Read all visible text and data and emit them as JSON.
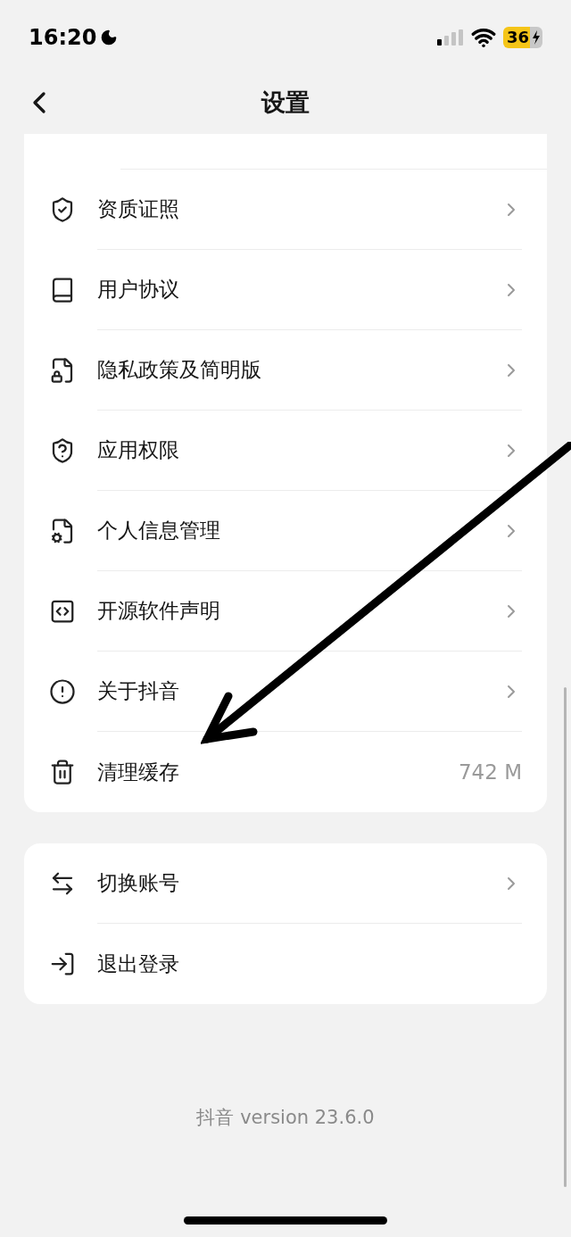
{
  "status_bar": {
    "time": "16:20",
    "battery": "36"
  },
  "header": {
    "title": "设置"
  },
  "settings": [
    {
      "label": "资质证照",
      "kind": "link"
    },
    {
      "label": "用户协议",
      "kind": "link"
    },
    {
      "label": "隐私政策及简明版",
      "kind": "link"
    },
    {
      "label": "应用权限",
      "kind": "link"
    },
    {
      "label": "个人信息管理",
      "kind": "link"
    },
    {
      "label": "开源软件声明",
      "kind": "link"
    },
    {
      "label": "关于抖音",
      "kind": "link"
    },
    {
      "label": "清理缓存",
      "kind": "value",
      "value": "742 M"
    }
  ],
  "account": [
    {
      "label": "切换账号",
      "kind": "link"
    },
    {
      "label": "退出登录",
      "kind": "plain"
    }
  ],
  "footer": "抖音 version 23.6.0"
}
